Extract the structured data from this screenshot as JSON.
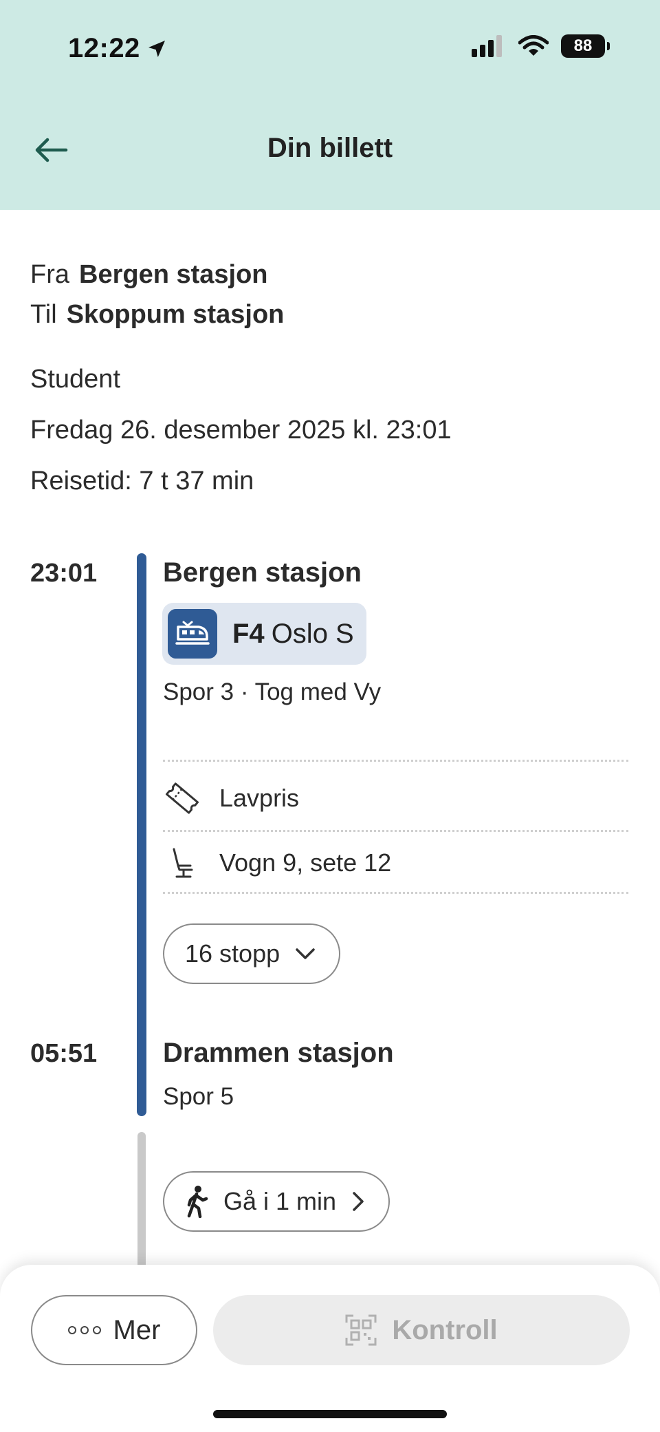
{
  "status_bar": {
    "time": "12:22",
    "battery": "88"
  },
  "header": {
    "title": "Din billett"
  },
  "route": {
    "from_label": "Fra",
    "from_value": "Bergen stasjon",
    "to_label": "Til",
    "to_value": "Skoppum stasjon"
  },
  "ticket": {
    "category": "Student",
    "datetime": "Fredag 26. desember 2025 kl. 23:01",
    "travel_time": "Reisetid: 7 t 37 min"
  },
  "leg": {
    "departure_time": "23:01",
    "departure_station": "Bergen stasjon",
    "line_code": "F4",
    "line_destination": "Oslo S",
    "departure_info": "Spor 3 · Tog med Vy",
    "fare": "Lavpris",
    "seat": "Vogn 9, sete 12",
    "stops_button": "16 stopp",
    "arrival_time": "05:51",
    "arrival_station": "Drammen stasjon",
    "arrival_platform": "Spor 5"
  },
  "walk": {
    "label": "Gå i 1 min"
  },
  "actions": {
    "more_label": "Mer",
    "control_label": "Kontroll"
  },
  "colors": {
    "header_bg": "#cdeae4",
    "accent_blue": "#2f5b95",
    "back_arrow": "#1f5c4f"
  }
}
